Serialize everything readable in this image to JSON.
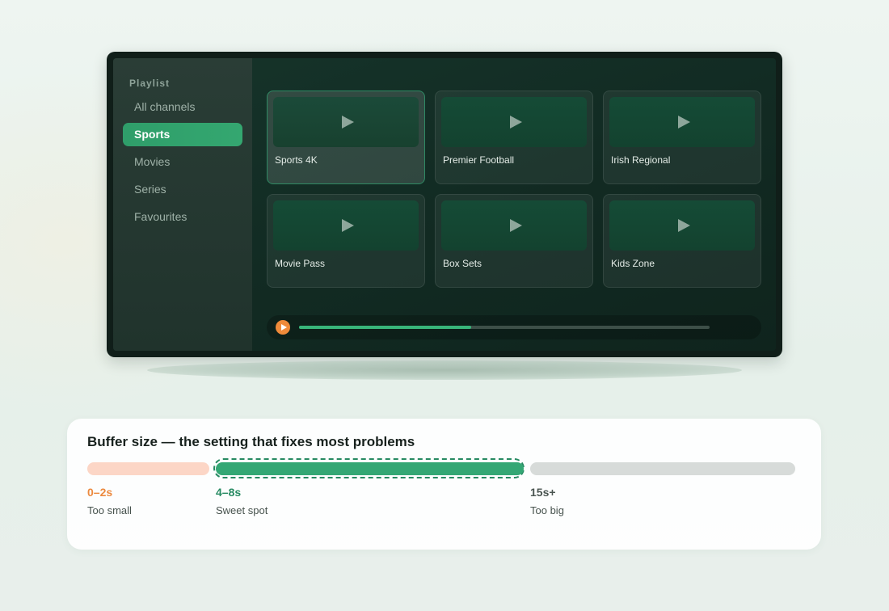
{
  "sidebar": {
    "title": "Playlist",
    "items": [
      {
        "label": "All channels",
        "active": false
      },
      {
        "label": "Sports",
        "active": true
      },
      {
        "label": "Movies",
        "active": false
      },
      {
        "label": "Series",
        "active": false
      },
      {
        "label": "Favourites",
        "active": false
      }
    ]
  },
  "channels": [
    {
      "label": "Sports 4K",
      "selected": true,
      "icon": "play-icon"
    },
    {
      "label": "Premier Football",
      "selected": false,
      "icon": "play-icon"
    },
    {
      "label": "Irish Regional",
      "selected": false,
      "icon": "play-icon"
    },
    {
      "label": "Movie Pass",
      "selected": false,
      "icon": "play-icon"
    },
    {
      "label": "Box Sets",
      "selected": false,
      "icon": "play-icon"
    },
    {
      "label": "Kids Zone",
      "selected": false,
      "icon": "play-icon"
    }
  ],
  "player": {
    "progress": 0.42,
    "play_icon": "play-icon",
    "play_color": "#ef8a3a",
    "progress_color": "#38b57a"
  },
  "buffer": {
    "title": "Buffer size — the setting that fixes most problems",
    "segments": [
      {
        "value": "0–2s",
        "label": "Too small",
        "bar_color": "#fcd6c6",
        "text_color": "#ec8a3f",
        "highlighted": false
      },
      {
        "value": "4–8s",
        "label": "Sweet spot",
        "bar_color": "#34a774",
        "text_color": "#278a62",
        "highlighted": true
      },
      {
        "value": "15s+",
        "label": "Too big",
        "bar_color": "#d7dbd9",
        "text_color": "#4a5551",
        "highlighted": false
      }
    ]
  },
  "colors": {
    "accent": "#34a770",
    "screen_bg": "#122b23"
  }
}
